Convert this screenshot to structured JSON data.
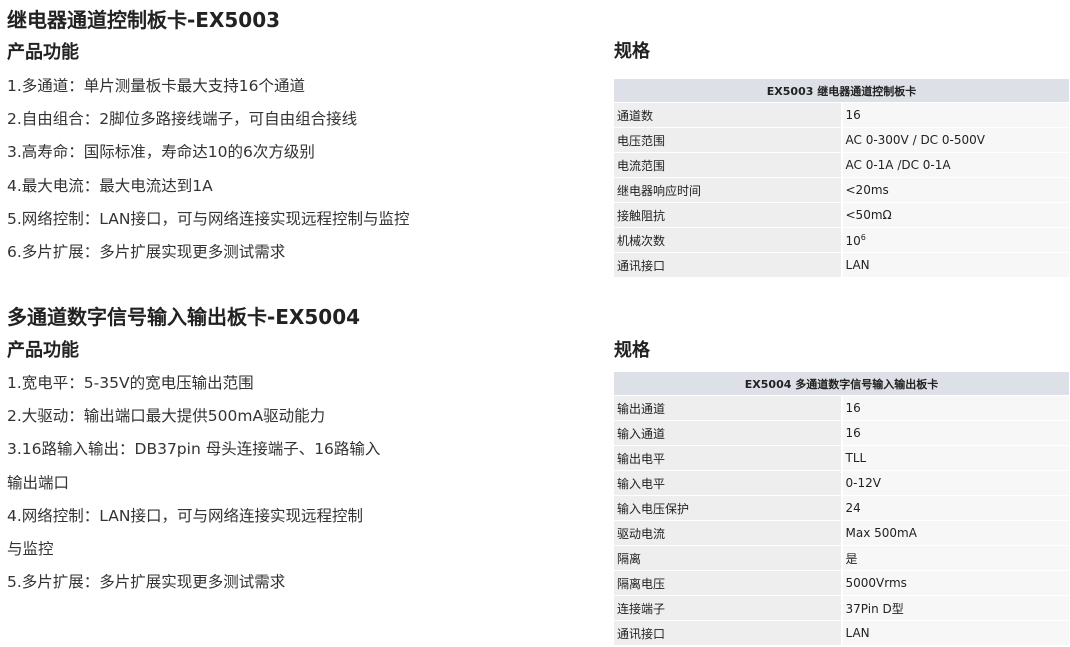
{
  "ex5003": {
    "title": "继电器通道控制板卡-EX5003",
    "features_heading": "产品功能",
    "features": [
      "1.多通道：单片测量板卡最大支持16个通道",
      "2.自由组合：2脚位多路接线端子，可自由组合接线",
      "3.高寿命：国际标准，寿命达10的6次方级别",
      "4.最大电流：最大电流达到1A",
      "5.网络控制：LAN接口，可与网络连接实现远程控制与监控",
      "6.多片扩展：多片扩展实现更多测试需求"
    ],
    "spec_heading": "规格",
    "spec_table": {
      "header": "EX5003 继电器通道控制板卡",
      "rows": [
        {
          "key": "通道数",
          "value": "16"
        },
        {
          "key": "电压范围",
          "value": "AC 0-300V / DC 0-500V"
        },
        {
          "key": "电流范围",
          "value": "AC 0-1A /DC 0-1A"
        },
        {
          "key": "继电器响应时间",
          "value": "<20ms"
        },
        {
          "key": "接触阻抗",
          "value": "<50mΩ"
        },
        {
          "key": "机械次数",
          "value": "10",
          "superscript": "6"
        },
        {
          "key": "通讯接口",
          "value": "LAN"
        }
      ]
    }
  },
  "ex5004": {
    "title": "多通道数字信号输入输出板卡-EX5004",
    "features_heading": "产品功能",
    "features": [
      "1.宽电平：5-35V的宽电压输出范围",
      "2.大驱动：输出端口最大提供500mA驱动能力",
      "3.16路输入输出：DB37pin 母头连接端子、16路输入",
      "输出端口",
      "4.网络控制：LAN接口，可与网络连接实现远程控制",
      "与监控",
      "5.多片扩展：多片扩展实现更多测试需求"
    ],
    "spec_heading": "规格",
    "spec_table": {
      "header": "EX5004 多通道数字信号输入输出板卡",
      "rows": [
        {
          "key": "输出通道",
          "value": "16"
        },
        {
          "key": "输入通道",
          "value": "16"
        },
        {
          "key": "输出电平",
          "value": "TLL"
        },
        {
          "key": "输入电平",
          "value": "0-12V"
        },
        {
          "key": "输入电压保护",
          "value": "24"
        },
        {
          "key": "驱动电流",
          "value": "Max 500mA"
        },
        {
          "key": "隔离",
          "value": "是"
        },
        {
          "key": "隔离电压",
          "value": "5000Vrms"
        },
        {
          "key": "连接端子",
          "value": "37Pin D型"
        },
        {
          "key": "通讯接口",
          "value": "LAN"
        }
      ]
    }
  }
}
